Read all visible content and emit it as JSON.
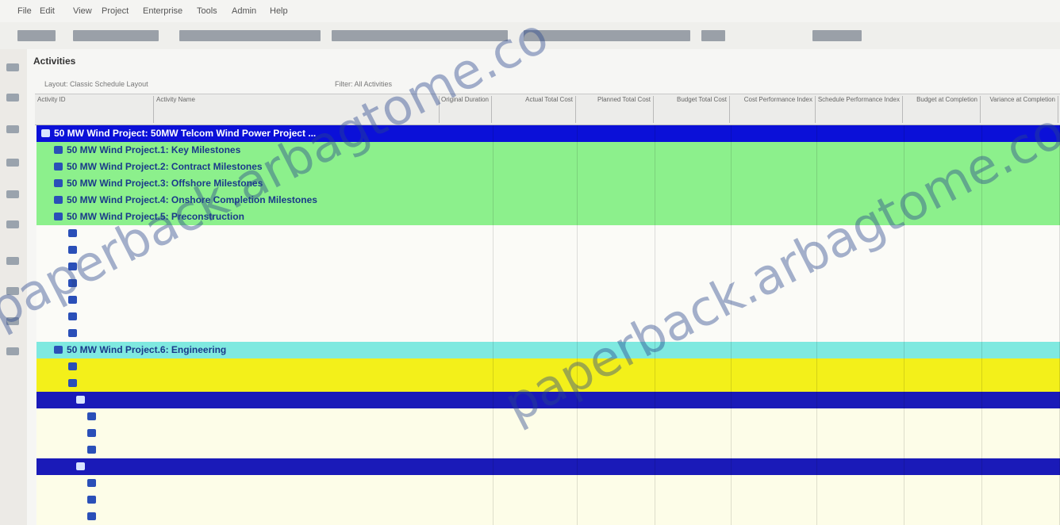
{
  "menu": [
    "File",
    "Edit",
    "View",
    "Project",
    "Enterprise",
    "Tools",
    "Admin",
    "Help"
  ],
  "panel": {
    "title": "Activities",
    "layout_label": "Layout: Classic Schedule Layout",
    "filter_label": "Filter: All Activities"
  },
  "columns": [
    {
      "id": "activity_id",
      "label": "Activity ID"
    },
    {
      "id": "activity_name",
      "label": "Activity Name"
    },
    {
      "id": "original_duration",
      "label": "Original Duration"
    },
    {
      "id": "actual_total_cost",
      "label": "Actual Total Cost"
    },
    {
      "id": "planned_total_cost",
      "label": "Planned Total Cost"
    },
    {
      "id": "budget_total_cost",
      "label": "Budget Total Cost"
    },
    {
      "id": "cost_performance_index",
      "label": "Cost Performance Index"
    },
    {
      "id": "schedule_performance_index",
      "label": "Schedule Performance Index"
    },
    {
      "id": "budget_at_completion",
      "label": "Budget at Completion"
    },
    {
      "id": "variance_at_completion",
      "label": "Variance at Completion"
    }
  ],
  "rows": [
    {
      "style": "blue",
      "name": "50 MW Wind Project: 50MW Telcom Wind Power Project ...",
      "values": [
        "",
        "",
        "",
        "",
        "",
        "",
        "",
        "",
        ""
      ]
    },
    {
      "style": "green",
      "name": "50 MW Wind Project.1: Key Milestones",
      "values": [
        "",
        "",
        "",
        "",
        "",
        "",
        "",
        "",
        ""
      ]
    },
    {
      "style": "green",
      "name": "50 MW Wind Project.2: Contract Milestones",
      "values": [
        "",
        "",
        "",
        "",
        "",
        "",
        "",
        "",
        ""
      ]
    },
    {
      "style": "green",
      "name": "50 MW Wind Project.3: Offshore Milestones",
      "values": [
        "",
        "",
        "",
        "",
        "",
        "",
        "",
        "",
        ""
      ]
    },
    {
      "style": "green",
      "name": "50 MW Wind Project.4: Onshore Completion Milestones",
      "values": [
        "",
        "",
        "",
        "",
        "",
        "",
        "",
        "",
        ""
      ]
    },
    {
      "style": "green",
      "name": "50 MW Wind Project.5: Preconstruction",
      "values": [
        "",
        "",
        "",
        "",
        "",
        "",
        "",
        "",
        ""
      ]
    },
    {
      "style": "white",
      "name": "",
      "values": [
        "",
        "",
        "",
        "",
        "",
        "",
        "",
        "",
        ""
      ]
    },
    {
      "style": "white",
      "name": "",
      "values": [
        "",
        "",
        "",
        "",
        "",
        "",
        "",
        "",
        ""
      ]
    },
    {
      "style": "white",
      "name": "",
      "values": [
        "",
        "",
        "",
        "",
        "",
        "",
        "",
        "",
        ""
      ]
    },
    {
      "style": "white",
      "name": "",
      "values": [
        "",
        "",
        "",
        "",
        "",
        "",
        "",
        "",
        ""
      ]
    },
    {
      "style": "white",
      "name": "",
      "values": [
        "",
        "",
        "",
        "",
        "",
        "",
        "",
        "",
        ""
      ]
    },
    {
      "style": "white",
      "name": "",
      "values": [
        "",
        "",
        "",
        "",
        "",
        "",
        "",
        "",
        ""
      ]
    },
    {
      "style": "white",
      "name": "",
      "values": [
        "",
        "",
        "",
        "",
        "",
        "",
        "",
        "",
        ""
      ]
    },
    {
      "style": "cyan",
      "name": "50 MW Wind Project.6: Engineering",
      "values": [
        "",
        "",
        "",
        "",
        "",
        "",
        "",
        "",
        ""
      ]
    },
    {
      "style": "yellow",
      "name": "",
      "values": [
        "",
        "",
        "",
        "",
        "",
        "",
        "",
        "",
        ""
      ]
    },
    {
      "style": "yellow",
      "name": "",
      "values": [
        "",
        "",
        "",
        "",
        "",
        "",
        "",
        "",
        ""
      ]
    },
    {
      "style": "navy",
      "name": "",
      "values": [
        "",
        "",
        "",
        "",
        "",
        "",
        "",
        "",
        ""
      ]
    },
    {
      "style": "lightyel",
      "name": "",
      "values": [
        "",
        "",
        "",
        "",
        "",
        "",
        "",
        "",
        ""
      ]
    },
    {
      "style": "lightyel",
      "name": "",
      "values": [
        "",
        "",
        "",
        "",
        "",
        "",
        "",
        "",
        ""
      ]
    },
    {
      "style": "lightyel",
      "name": "",
      "values": [
        "",
        "",
        "",
        "",
        "",
        "",
        "",
        "",
        ""
      ]
    },
    {
      "style": "navy",
      "name": "",
      "values": [
        "",
        "",
        "",
        "",
        "",
        "",
        "",
        "",
        ""
      ]
    },
    {
      "style": "lightyel",
      "name": "",
      "values": [
        "",
        "",
        "",
        "",
        "",
        "",
        "",
        "",
        ""
      ]
    },
    {
      "style": "lightyel",
      "name": "",
      "values": [
        "",
        "",
        "",
        "",
        "",
        "",
        "",
        "",
        ""
      ]
    },
    {
      "style": "lightyel",
      "name": "",
      "values": [
        "",
        "",
        "",
        "",
        "",
        "",
        "",
        "",
        ""
      ]
    }
  ],
  "watermark": "paperback.arbagtome.co",
  "colors": {
    "wbs_root": "#0b10d8",
    "wbs_level1": "#8cf08c",
    "wbs_level2": "#f3f01a",
    "wbs_level3": "#1a1ab8",
    "activity_row": "#fbfbf7"
  }
}
